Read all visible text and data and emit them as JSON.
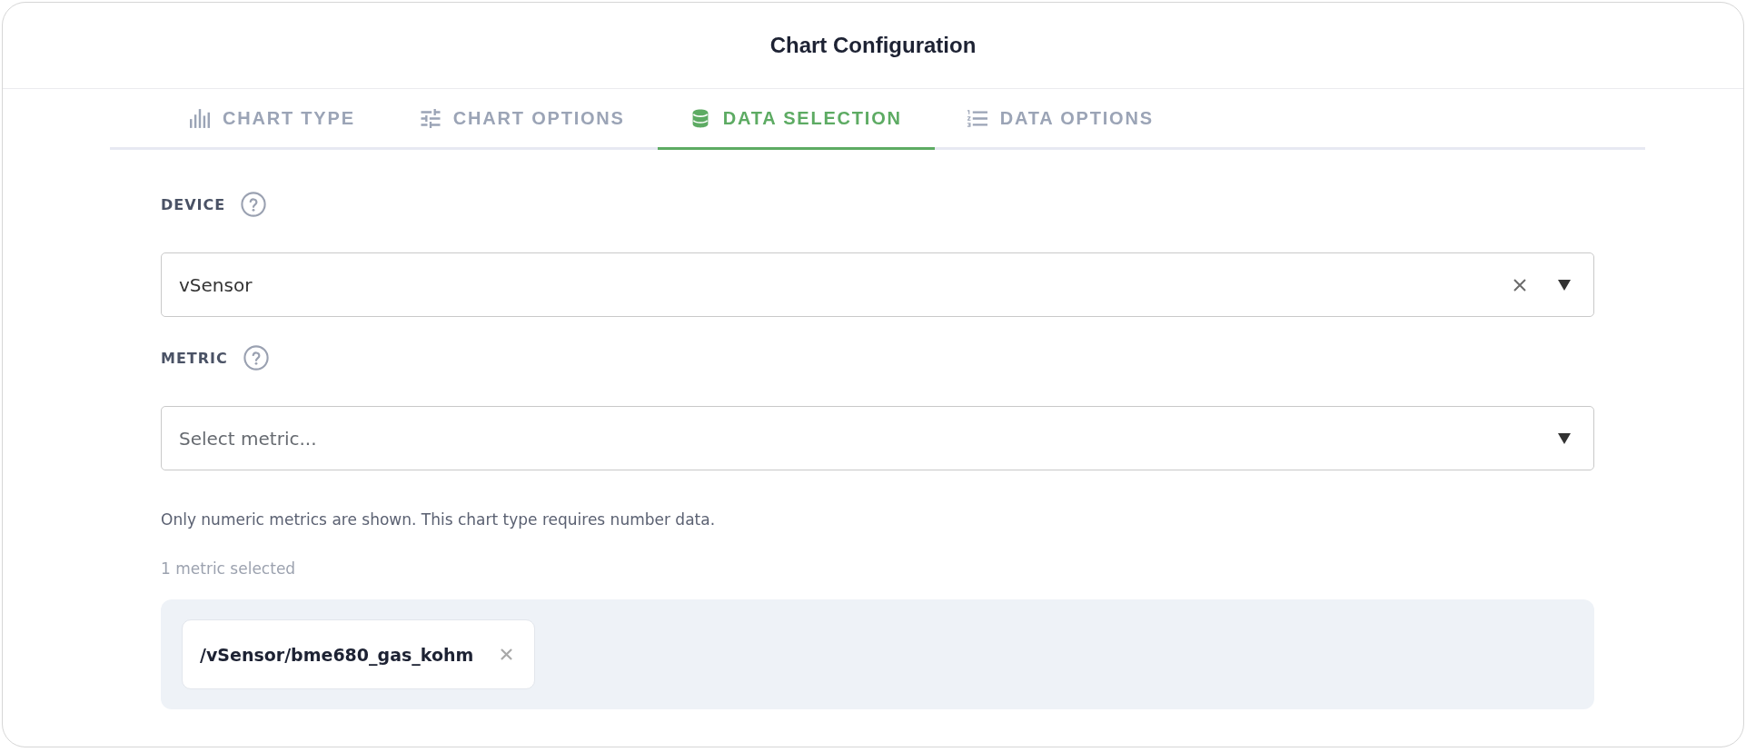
{
  "dialog": {
    "title": "Chart Configuration"
  },
  "tabs": [
    {
      "label": "CHART TYPE",
      "selected": false
    },
    {
      "label": "CHART OPTIONS",
      "selected": false
    },
    {
      "label": "DATA SELECTION",
      "selected": true
    },
    {
      "label": "DATA OPTIONS",
      "selected": false
    }
  ],
  "fields": [
    {
      "label": "DEVICE",
      "value": "vSensor"
    },
    {
      "label": "METRIC",
      "placeholder": "Select metric..."
    }
  ],
  "hint": "Only numeric metrics are shown. This chart type requires number data.",
  "selection_count": "1 metric selected",
  "selected_metrics": [
    {
      "path": "/vSensor/bme680_gas_kohm"
    }
  ]
}
